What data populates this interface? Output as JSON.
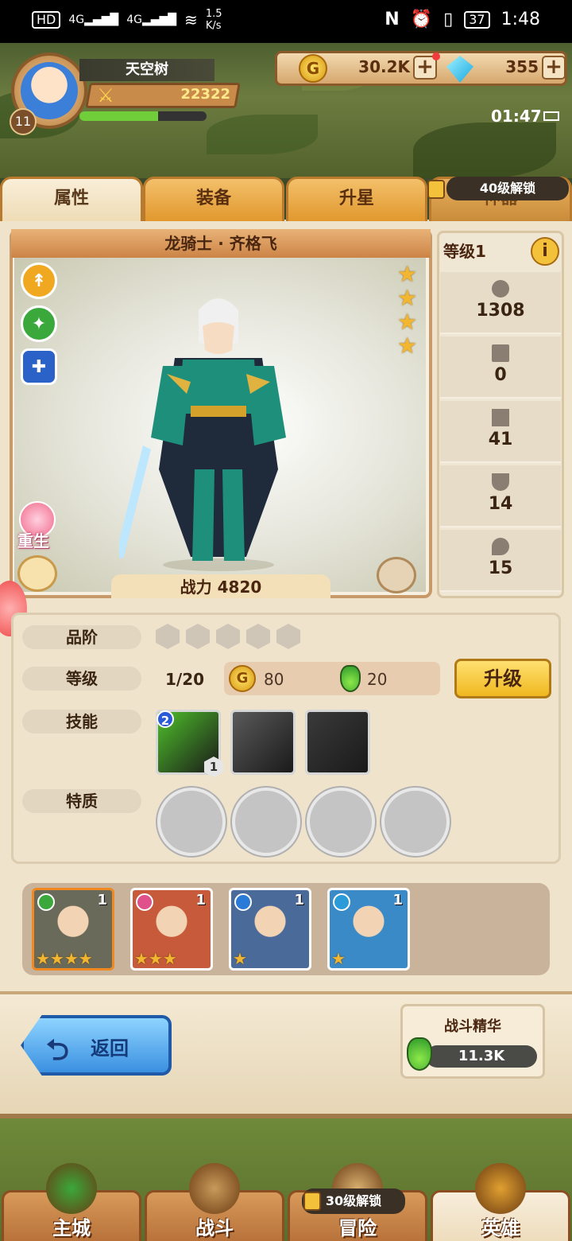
{
  "status_bar": {
    "left_chips": [
      "HD",
      "4G",
      "4G"
    ],
    "speed_value": "1.5",
    "speed_unit": "K/s",
    "battery": "37",
    "time": "1:48"
  },
  "player": {
    "name": "天空树",
    "level": "11",
    "power": "22322",
    "xp_fraction": 0.62
  },
  "currency": {
    "gold": "30.2K",
    "gold_icon": "G",
    "diamonds": "355",
    "plus": "+"
  },
  "timer": "01:47",
  "tabs": [
    {
      "label": "属性",
      "state": "active"
    },
    {
      "label": "装备",
      "state": "inactive"
    },
    {
      "label": "升星",
      "state": "inactive"
    },
    {
      "label": "神器",
      "state": "locked"
    }
  ],
  "tab_lock_text": "40级解锁",
  "hero": {
    "title": "龙骑士 · 齐格飞",
    "stars": 4,
    "power_label": "战力 4820",
    "rebirth_label": "重生"
  },
  "stats": {
    "level_label": "等级1",
    "info": "i",
    "values": [
      {
        "icon": "heart-icon",
        "value": "1308"
      },
      {
        "icon": "sword-icon",
        "value": "0"
      },
      {
        "icon": "dagger-icon",
        "value": "41"
      },
      {
        "icon": "shield-icon",
        "value": "14"
      },
      {
        "icon": "drop-icon",
        "value": "15"
      }
    ]
  },
  "details": {
    "quality_label": "品阶",
    "quality_steps": 5,
    "level_label": "等级",
    "level_value": "1/20",
    "gold_cost": "80",
    "potion_cost": "20",
    "upgrade_button": "升级",
    "skills_label": "技能",
    "skills": [
      {
        "badge_top": "2",
        "badge_bottom": "1",
        "color": "#4fbf2a"
      },
      {
        "badge_top": "",
        "badge_bottom": "",
        "color": "#5a5a5a"
      },
      {
        "badge_top": "",
        "badge_bottom": "",
        "color": "#3a3a3a"
      }
    ],
    "traits_label": "特质",
    "trait_slots": 4
  },
  "roster": [
    {
      "count": "1",
      "stars": "★★★★",
      "bg": "#6a6a5a",
      "border": "#f08a20",
      "class_color": "#3aa83a"
    },
    {
      "count": "1",
      "stars": "★★★",
      "bg": "#c65a3a",
      "border": "#ffffff",
      "class_color": "#e0508a"
    },
    {
      "count": "1",
      "stars": "★",
      "bg": "#4a6a9a",
      "border": "#ffffff",
      "class_color": "#2a7ad8"
    },
    {
      "count": "1",
      "stars": "★",
      "bg": "#3a8ac8",
      "border": "#ffffff",
      "class_color": "#2a9ad8"
    }
  ],
  "back_button": "返回",
  "essence": {
    "title": "战斗精华",
    "value": "11.3K"
  },
  "bottom_nav": [
    {
      "label": "主城",
      "state": "inactive"
    },
    {
      "label": "战斗",
      "state": "inactive"
    },
    {
      "label": "冒险",
      "state": "locked"
    },
    {
      "label": "英雄",
      "state": "active"
    }
  ],
  "nav_lock_text": "30级解锁"
}
